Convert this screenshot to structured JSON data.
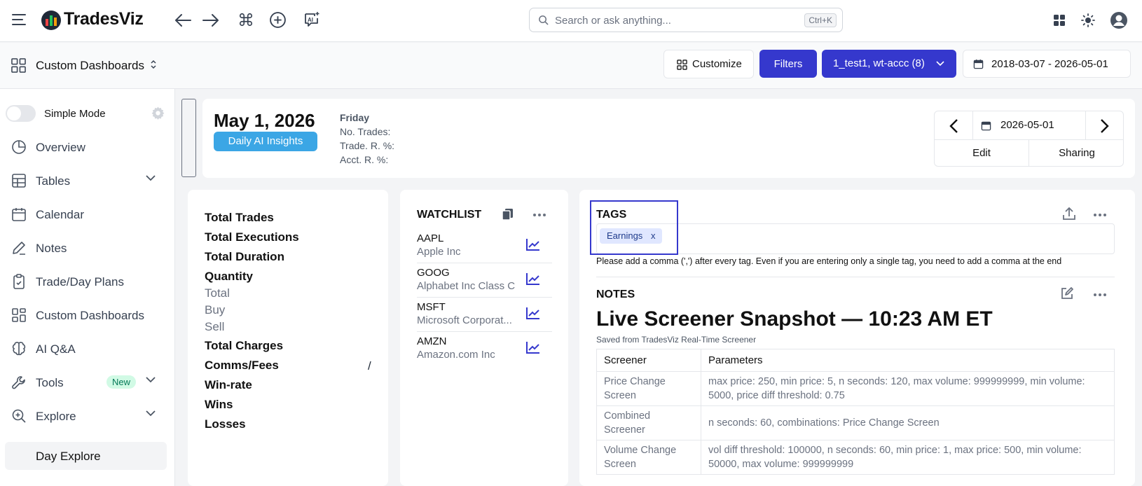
{
  "app": {
    "name": "TradesViz"
  },
  "search": {
    "placeholder": "Search or ask anything...",
    "shortcut": "Ctrl+K"
  },
  "subbar": {
    "title": "Custom Dashboards",
    "customize_label": "Customize",
    "filters_label": "Filters",
    "account_label": "1_test1, wt-accc (8)",
    "date_range": "2018-03-07 - 2026-05-01"
  },
  "colors": {
    "primary": "#3538cd",
    "ai_button": "#3ba6e5",
    "tags_highlight": "#3538cd"
  },
  "sidebar": {
    "simple_mode_label": "Simple Mode",
    "items": [
      {
        "label": "Overview",
        "icon": "pie-chart-icon"
      },
      {
        "label": "Tables",
        "icon": "table-icon"
      },
      {
        "label": "Calendar",
        "icon": "calendar-icon"
      },
      {
        "label": "Notes",
        "icon": "pencil-icon"
      },
      {
        "label": "Trade/Day Plans",
        "icon": "clipboard-icon"
      },
      {
        "label": "Custom Dashboards",
        "icon": "dashboard-icon"
      },
      {
        "label": "AI Q&A",
        "icon": "brain-icon"
      },
      {
        "label": "Tools",
        "icon": "wrench-icon",
        "badge": "New"
      },
      {
        "label": "Explore",
        "icon": "zoom-icon"
      },
      {
        "label": "Day Explore"
      }
    ]
  },
  "day_header": {
    "date": "May 1, 2026",
    "ai_button": "Daily AI Insights",
    "weekday": "Friday",
    "no_trades_label": "No. Trades:",
    "trade_r_label": "Trade. R. %:",
    "acct_r_label": "Acct. R. %:",
    "picker_date": "2026-05-01",
    "edit_label": "Edit",
    "sharing_label": "Sharing"
  },
  "stats": {
    "total_trades": "Total Trades",
    "total_executions": "Total Executions",
    "total_duration": "Total Duration",
    "quantity": "Quantity",
    "total": "Total",
    "buy": "Buy",
    "sell": "Sell",
    "total_charges": "Total Charges",
    "comms_fees": "Comms/Fees",
    "comms_sep": "/",
    "win_rate": "Win-rate",
    "wins": "Wins",
    "losses": "Losses"
  },
  "watchlist": {
    "title": "WATCHLIST",
    "items": [
      {
        "symbol": "AAPL",
        "name": "Apple Inc"
      },
      {
        "symbol": "GOOG",
        "name": "Alphabet Inc Class C"
      },
      {
        "symbol": "MSFT",
        "name": "Microsoft Corporat..."
      },
      {
        "symbol": "AMZN",
        "name": "Amazon.com Inc"
      }
    ]
  },
  "tags": {
    "title": "TAGS",
    "chip": "Earnings",
    "chip_remove": "x",
    "hint": "Please add a comma (',') after every tag. Even if you are entering only a single tag, you need to add a comma at the end"
  },
  "notes": {
    "title": "NOTES",
    "heading": "Live Screener Snapshot — 10:23 AM ET",
    "subtitle": "Saved from TradesViz Real-Time Screener",
    "table": {
      "headers": [
        "Screener",
        "Parameters"
      ],
      "rows": [
        [
          "Price Change Screen",
          "max price: 250, min price: 5, n seconds: 120, max volume: 999999999, min volume: 5000, price diff threshold: 0.75"
        ],
        [
          "Combined Screener",
          "n seconds: 60, combinations: Price Change Screen"
        ],
        [
          "Volume Change Screen",
          "vol diff threshold: 100000, n seconds: 60, min price: 1, max price: 500, min volume: 50000, max volume: 999999999"
        ]
      ]
    }
  }
}
